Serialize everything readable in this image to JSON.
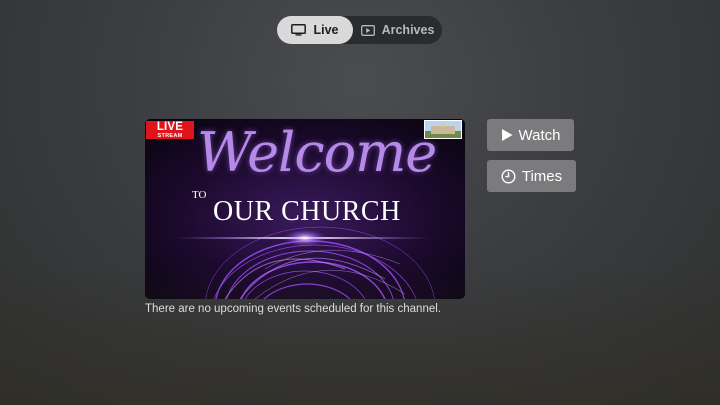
{
  "tabs": {
    "live": {
      "label": "Live",
      "icon": "tv-icon",
      "selected": true
    },
    "archives": {
      "label": "Archives",
      "icon": "play-rectangle-icon",
      "selected": false
    }
  },
  "thumbnail": {
    "badge": {
      "main": "LIVE",
      "sub": "STREAM",
      "color": "#e0141b"
    },
    "headline": "Welcome",
    "connector": "TO",
    "subheadline": "OUR CHURCH",
    "accent_color": "#b58ae8"
  },
  "status_message": "There are no upcoming events scheduled for this channel.",
  "actions": {
    "watch": {
      "label": "Watch",
      "icon": "play-icon"
    },
    "times": {
      "label": "Times",
      "icon": "clock-icon"
    }
  },
  "colors": {
    "button_bg": "#7b7b7d",
    "segment_selected_bg": "#d9d9da",
    "segment_track_bg": "#2a2b2d"
  }
}
